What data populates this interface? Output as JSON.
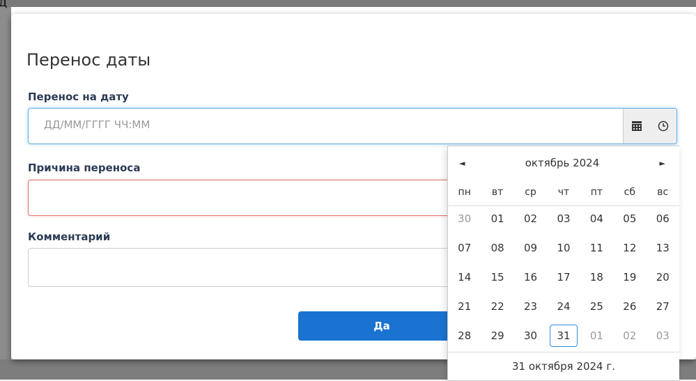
{
  "caption": {
    "fragment": "д"
  },
  "dialog": {
    "title": "Перенос даты",
    "date_field": {
      "label": "Перенос на дату",
      "placeholder": "ДД/ММ/ГГГГ ЧЧ:ММ"
    },
    "reason_field": {
      "label": "Причина переноса",
      "value": ""
    },
    "comment_field": {
      "label": "Комментарий",
      "value": ""
    },
    "confirm_button": "Да"
  },
  "datepicker": {
    "month_label": "октябрь 2024",
    "prev": "◄",
    "next": "►",
    "weekdays": [
      "пн",
      "вт",
      "ср",
      "чт",
      "пт",
      "сб",
      "вс"
    ],
    "weeks": [
      [
        "30",
        "01",
        "02",
        "03",
        "04",
        "05",
        "06"
      ],
      [
        "07",
        "08",
        "09",
        "10",
        "11",
        "12",
        "13"
      ],
      [
        "14",
        "15",
        "16",
        "17",
        "18",
        "19",
        "20"
      ],
      [
        "21",
        "22",
        "23",
        "24",
        "25",
        "26",
        "27"
      ],
      [
        "28",
        "29",
        "30",
        "31",
        "01",
        "02",
        "03"
      ]
    ],
    "muted": [
      [
        0,
        0
      ],
      [
        4,
        4
      ],
      [
        4,
        5
      ],
      [
        4,
        6
      ]
    ],
    "today": [
      4,
      3
    ],
    "footer": "31 октября 2024 г."
  }
}
